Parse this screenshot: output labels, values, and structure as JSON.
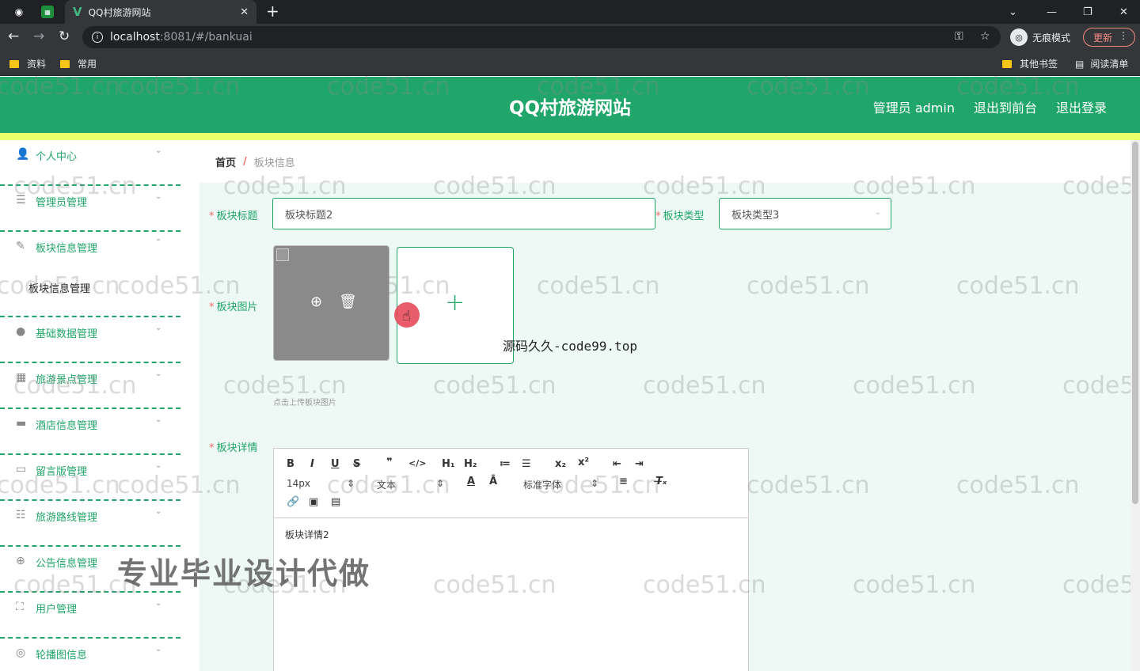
{
  "browser": {
    "tab_title": "QQ村旅游网站",
    "url_host": "localhost",
    "url_path": ":8081/#/bankuai",
    "profile_label": "无痕模式",
    "update_label": "更新",
    "bookmarks": [
      "资料",
      "常用"
    ],
    "other_bookmarks": "其他书签",
    "reading_list": "阅读清单"
  },
  "header": {
    "title": "QQ村旅游网站",
    "admin_label": "管理员 admin",
    "back_front": "退出到前台",
    "logout": "退出登录"
  },
  "sidebar": {
    "items": [
      {
        "label": "个人中心",
        "icon": "user-icon",
        "arrow": "⌄"
      },
      {
        "label": "管理员管理",
        "icon": "list-icon",
        "arrow": "⌄"
      },
      {
        "label": "板块信息管理",
        "icon": "edit-icon",
        "arrow": "⌃"
      },
      {
        "label": "基础数据管理",
        "icon": "bulb-icon",
        "arrow": "⌄"
      },
      {
        "label": "旅游景点管理",
        "icon": "grid-icon",
        "arrow": "⌄"
      },
      {
        "label": "酒店信息管理",
        "icon": "hotel-icon",
        "arrow": "⌄"
      },
      {
        "label": "留言版管理",
        "icon": "message-icon",
        "arrow": "⌄"
      },
      {
        "label": "旅游路线管理",
        "icon": "sliders-icon",
        "arrow": "⌄"
      },
      {
        "label": "公告信息管理",
        "icon": "globe-icon",
        "arrow": "⌄"
      },
      {
        "label": "用户管理",
        "icon": "frame-icon",
        "arrow": "⌄"
      },
      {
        "label": "轮播图信息",
        "icon": "carousel-icon",
        "arrow": "⌄"
      }
    ],
    "sub_item": "板块信息管理"
  },
  "breadcrumb": {
    "home": "首页",
    "separator": "/",
    "current": "板块信息"
  },
  "form": {
    "title_label": "板块标题",
    "title_value": "板块标题2",
    "type_label": "板块类型",
    "type_value": "板块类型3",
    "image_label": "板块图片",
    "upload_tip": "点击上传板块图片",
    "detail_label": "板块详情",
    "detail_value": "板块详情2"
  },
  "editor": {
    "font_size": "14px",
    "block_type": "文本",
    "font_family": "标准字体"
  },
  "overlays": {
    "watermark": "code51.cn",
    "source_text": "源码久久-code99.top",
    "ad_text": "专业毕业设计代做"
  },
  "colors": {
    "primary": "#20a56a",
    "header_accent": "#eaff6a",
    "required": "#f56c6c"
  }
}
